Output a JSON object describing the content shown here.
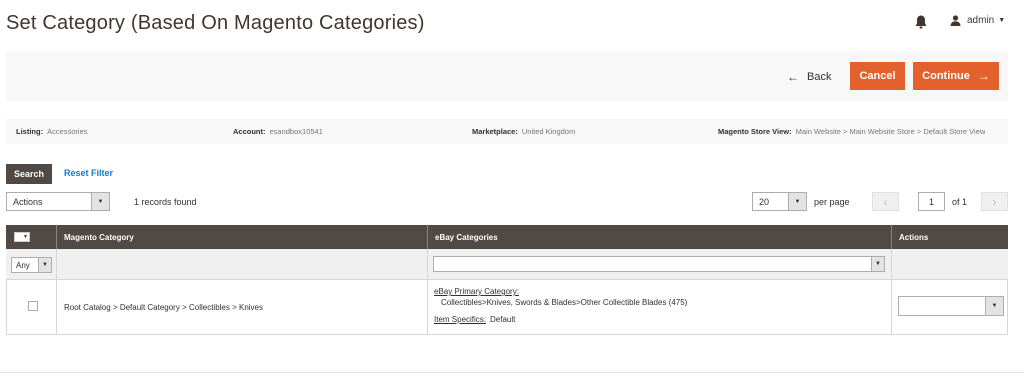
{
  "header": {
    "title": "Set Category (Based On Magento Categories)",
    "user_name": "admin",
    "bell_icon": "bell-icon",
    "user_icon": "user-icon"
  },
  "action_bar": {
    "back_label": "Back",
    "cancel_label": "Cancel",
    "continue_label": "Continue",
    "accent_color": "#e3612d"
  },
  "info": {
    "listing_label": "Listing:",
    "listing_value": "Accessories",
    "account_label": "Account:",
    "account_value": "esandbox10541",
    "marketplace_label": "Marketplace:",
    "marketplace_value": "United  Kingdom",
    "store_view_label": "Magento Store View:",
    "store_view_value": "Main Website > Main Website Store > Default Store View"
  },
  "toolbar": {
    "search_label": "Search",
    "reset_label": "Reset Filter",
    "actions_value": "Actions",
    "records_found": "1 records found",
    "per_page_value": "20",
    "per_page_label": "per page",
    "page_value": "1",
    "of_pages": "of 1"
  },
  "grid": {
    "columns": [
      "Magento Category",
      "eBay Categories",
      "Actions"
    ],
    "filter_any": "Any",
    "rows": [
      {
        "magento_category": "Root Catalog > Default Category > Collectibles > Knives",
        "ebay_primary_label": "eBay Primary Category:",
        "ebay_primary_value": "Collectibles>Knives, Swords & Blades>Other Collectible Blades (475)",
        "item_specifics_label": "Item Specifics:",
        "item_specifics_value": "Default"
      }
    ]
  }
}
